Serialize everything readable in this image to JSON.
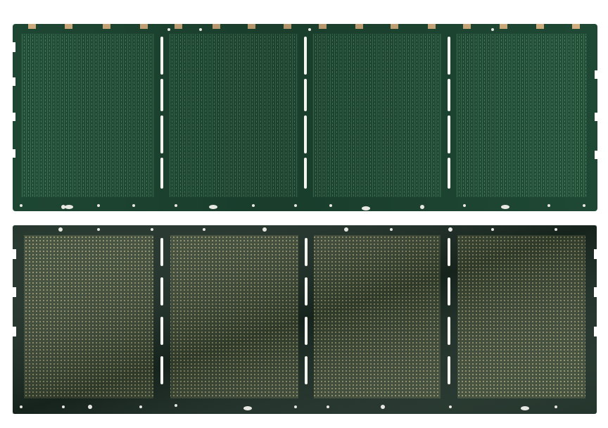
{
  "scene": {
    "subject": "two-pcb-panels",
    "background": "#ffffff"
  },
  "colors": {
    "solder_mask_top": "#1f4a35",
    "solder_mask_bottom": "#1b2d24",
    "gold_fingers": "#d8b483",
    "copper_grid_top": "#5f8a68",
    "pad_grid_bottom": "#8a8a62",
    "slot": "#f4f4f0"
  },
  "panels": [
    {
      "id": "top",
      "side": "component-side",
      "array_count": 4,
      "has_edge_gold_tabs": true
    },
    {
      "id": "bottom",
      "side": "pad-side",
      "array_count": 4,
      "has_edge_gold_tabs": false
    }
  ]
}
